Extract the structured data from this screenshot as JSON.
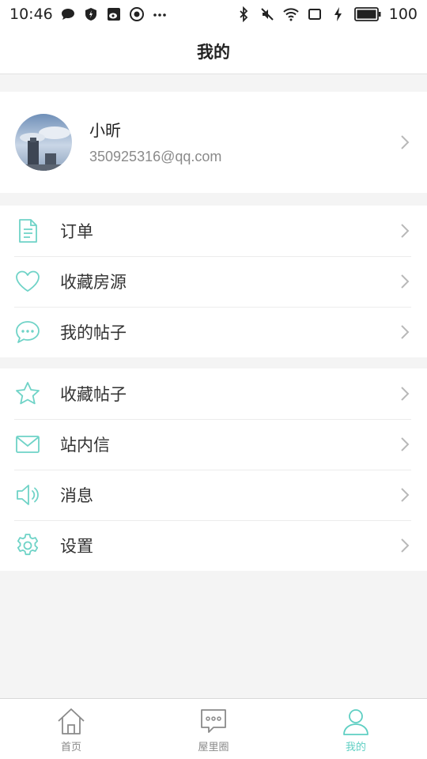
{
  "status_bar": {
    "time": "10:46",
    "battery_level": "100"
  },
  "header": {
    "title": "我的"
  },
  "profile": {
    "name": "小昕",
    "email": "350925316@qq.com"
  },
  "menu_group_1": [
    {
      "label": "订单",
      "icon": "document-icon"
    },
    {
      "label": "收藏房源",
      "icon": "heart-icon"
    },
    {
      "label": "我的帖子",
      "icon": "chat-bubble-icon"
    }
  ],
  "menu_group_2": [
    {
      "label": "收藏帖子",
      "icon": "star-icon"
    },
    {
      "label": "站内信",
      "icon": "mail-icon"
    },
    {
      "label": "消息",
      "icon": "speaker-icon"
    },
    {
      "label": "设置",
      "icon": "gear-icon"
    }
  ],
  "tabs": [
    {
      "label": "首页",
      "icon": "home-icon",
      "active": false
    },
    {
      "label": "屋里圈",
      "icon": "message-icon",
      "active": false
    },
    {
      "label": "我的",
      "icon": "user-icon",
      "active": true
    }
  ],
  "colors": {
    "accent": "#5fcfc3",
    "icon_teal": "#6fd3c7",
    "chevron": "#b8b8b8",
    "background": "#f4f4f4"
  }
}
